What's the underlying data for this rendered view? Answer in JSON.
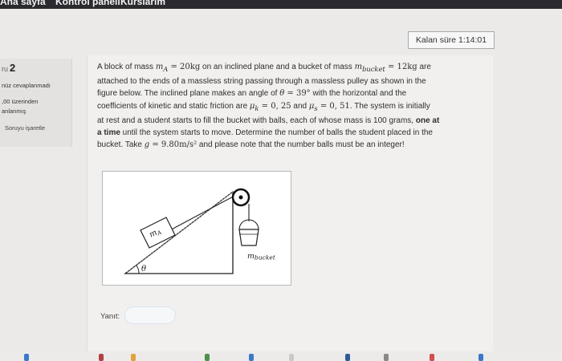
{
  "topbar": {
    "items": [
      "Ana sayfa",
      "Kontrol paneli",
      "Kurslarım"
    ]
  },
  "sidebar": {
    "question_prefix": "ru",
    "question_number": "2",
    "status": "nüz cevaplanmadı",
    "points_line1": ",00 üzerinden",
    "points_line2": "anlanmış",
    "flag_label": "Soruyu işaretle"
  },
  "timer": {
    "label": "Kalan süre 1:14:01"
  },
  "question": {
    "l1_a": "A block of mass ",
    "l1_m": "m",
    "l1_msub": "A",
    "l1_eq": " = 20kg",
    "l1_b": " on an inclined plane and a bucket of mass ",
    "l1_mb": "m",
    "l1_mbsub": "bucket",
    "l1_eq2": " = 12kg",
    "l1_c": " are",
    "l2": "attached to the ends of a massless string passing through a massless pulley as shown in the",
    "l3_a": "figure below. The inclined plane makes an angle of ",
    "l3_theta": "θ",
    "l3_eq": " = 39°",
    "l3_b": " with the horizontal and the",
    "l4_a": "coefficients of kinetic and static friction are ",
    "l4_mu": "μ",
    "l4_k": "k",
    "l4_eq": " = 0, 25",
    "l4_and": " and ",
    "l4_mu2": "μ",
    "l4_s": "s",
    "l4_eq2": " = 0, 51",
    "l4_b": ". The system is initially",
    "l5_a": "at rest and a student starts to fill the bucket with balls, each of whose mass is 100 grams, ",
    "l5_bold": "one at",
    "l6_bold": "a time",
    "l6_b": " until the system starts to move. Determine the number of balls the student placed in the",
    "l7_a": "bucket. Take ",
    "l7_g": "g",
    "l7_eq": " = 9.80m/s²",
    "l7_b": " and please note that the number balls must be an integer!"
  },
  "figure": {
    "block_label": "m",
    "block_sub": "A",
    "bucket_label": "m",
    "bucket_sub": "bucket",
    "angle_label": "θ"
  },
  "answer": {
    "label": "Yanıt:",
    "value": "",
    "placeholder": ""
  },
  "colors": {
    "topbar_bg": "#2a2a2f",
    "page_bg": "#eceae8",
    "question_bg": "#f1f0ef",
    "input_border": "#d9e3ef"
  }
}
